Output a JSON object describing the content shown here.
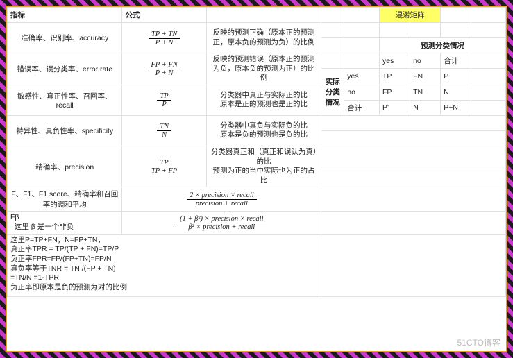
{
  "headers": {
    "metric": "指标",
    "formula": "公式"
  },
  "rows": [
    {
      "metric": "准确率、识别率、accuracy",
      "num": "TP + TN",
      "den": "P + N",
      "desc": "反映的预测正确（原本正的预测正，原本负的预测为负）的比例"
    },
    {
      "metric": "错误率、误分类率、error rate",
      "num": "FP + FN",
      "den": "P + N",
      "desc": "反映的预测错误（原本正的预测为负，原本负的预测为正）的比例"
    },
    {
      "metric": "敏感性、真正性率、召回率、recall",
      "num": "TP",
      "den": "P",
      "desc": "分类器中真正与实际正的比\n原本是正的预测也是正的比"
    },
    {
      "metric": "特异性、真负性率、specificity",
      "num": "TN",
      "den": "N",
      "desc": "分类器中真负与实际负的比\n原本是负的预测也是负的比"
    },
    {
      "metric": "精确率、precision",
      "num": "TP",
      "den": "TP + FP",
      "desc": "分类器真正和（真正和误认为真）的比\n预测为正的当中实际也为正的占比"
    }
  ],
  "f1": {
    "metric": "F、F1、F1 score、精确率和召回率的调和平均",
    "num": "2 × precision × recall",
    "den": "precision + recall"
  },
  "fbeta": {
    "label": "Fβ",
    "note": "这里 β 是一个非负",
    "num": "(1 + β²) × precision × recall",
    "den": "β² × precision + recall"
  },
  "notes": "这里P=TP+FN，N=FP+TN，\n真正率TPR = TP/(TP + FN)=TP/P\n负正率FPR=FP/(FP+TN)=FP/N\n真负率等于TNR = TN /(FP + TN)\n=TN/N =1-TPR\n负正率即原本是负的预测为对的比例",
  "confusion": {
    "title": "混淆矩阵",
    "pred_header": "预测分类情况",
    "actual_header": "实际分类情况",
    "cols": [
      "",
      "yes",
      "no",
      "合计"
    ],
    "rows": [
      [
        "yes",
        "TP",
        "FN",
        "P"
      ],
      [
        "no",
        "FP",
        "TN",
        "N"
      ],
      [
        "合计",
        "P'",
        "N'",
        "P+N"
      ]
    ]
  },
  "watermark": "51CTO博客"
}
